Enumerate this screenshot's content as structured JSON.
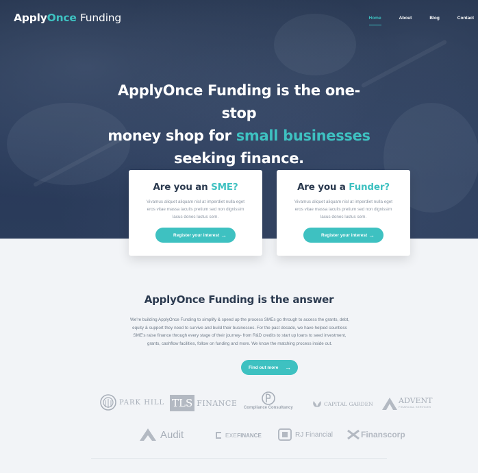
{
  "brand": {
    "part1": "Apply",
    "part2": "Once",
    "part3": "Funding"
  },
  "nav": {
    "items": [
      "Home",
      "About",
      "Blog",
      "Contact"
    ],
    "active": "Home"
  },
  "hero": {
    "line1": "ApplyOnce Funding is the one-stop",
    "line2_pre": "money shop for ",
    "line2_accent": "small businesses",
    "line3": "seeking finance."
  },
  "cards": {
    "sme": {
      "title_pre": "Are you an ",
      "title_accent": "SME?",
      "text": "Vivamus aliquet aliquam nisl at imperdiet nulla eget eros vitae massa iaculis pretium sed non dignissim lacus donec luctus sem.",
      "button": "Register your interest",
      "arrow": "→"
    },
    "funder": {
      "title_pre": "Are you a ",
      "title_accent": "Funder?",
      "text": "Vivamus aliquet aliquam nisl at imperdiet nulla eget eros vitae massa iaculis pretium sed non dignissim lacus donec luctus sem.",
      "button": "Register your interest",
      "arrow": "→"
    }
  },
  "answer": {
    "title": "ApplyOnce Funding is the answer",
    "body": "We're building ApplyOnce Funding to simplify & speed up the process SMEs go through to access the grants, debt, equity & support they need to survive and build their businesses. For the past decade, we have helped countless SME's raise finance through every stage of their journey- from R&D credits to start up loans to seed investment, grants, cashflow facilities, follow on funding and more. We know the matching process inside out.",
    "button": "Find out more",
    "arrow": "→"
  },
  "partners": {
    "parkhill": "PARK HILL",
    "tls_box": "TLS",
    "tls_text": "FINANCE",
    "compliance": "Compliance Consultancy",
    "capital_garden": "CAPITAL GARDEN",
    "advent": "ADVENT",
    "advent_sub": "FINANCIAL SERVICES",
    "audit": "Audit",
    "exe": "EXE",
    "exe2": "FINANCE",
    "rj": "RJ Financial",
    "finanscorp": "Finanscorp"
  },
  "colors": {
    "accent": "#3ec1c1",
    "dark": "#2b3a4f",
    "hero": "#273857"
  }
}
